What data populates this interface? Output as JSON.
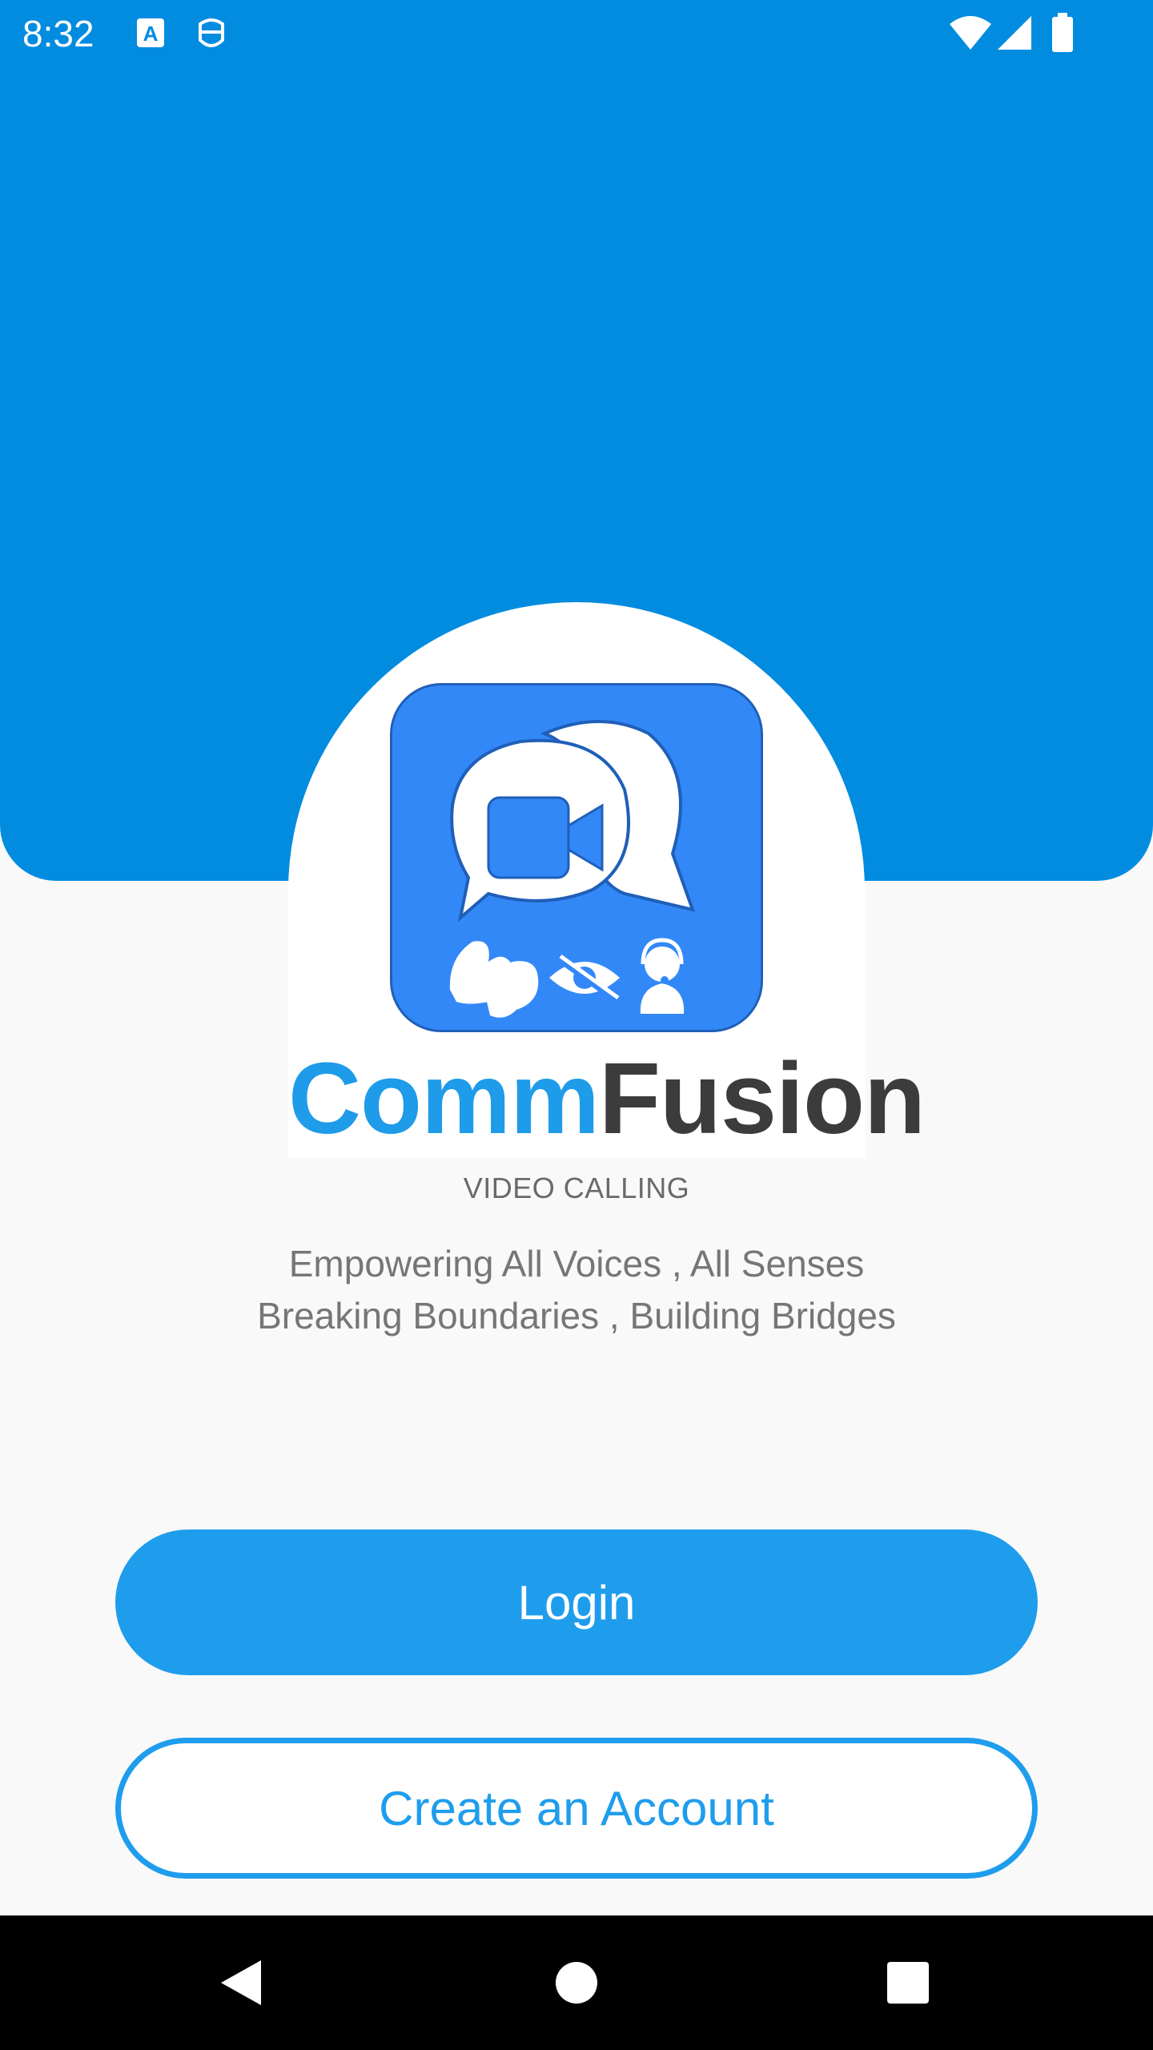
{
  "status_bar": {
    "time": "8:32",
    "icons": [
      "text-a-icon",
      "smile-face-icon",
      "wifi-icon",
      "signal-icon",
      "battery-icon"
    ]
  },
  "branding": {
    "name_part1": "Comm",
    "name_part2": "Fusion",
    "subtitle": "VIDEO CALLING",
    "tagline_line1": "Empowering All Voices , All Senses",
    "tagline_line2": "Breaking Boundaries , Building Bridges",
    "logo_icons": [
      "video-camera-icon",
      "sign-language-icon",
      "eye-slash-icon",
      "headset-person-icon"
    ]
  },
  "actions": {
    "login_label": "Login",
    "create_account_label": "Create an Account"
  },
  "nav_bar": {
    "icons": [
      "back-triangle-icon",
      "home-circle-icon",
      "recents-square-icon"
    ]
  },
  "colors": {
    "header_blue": "#028ce0",
    "brand_blue": "#1e9be9",
    "brand_dark": "#3c3c3c",
    "button_blue": "#1f9ded",
    "icon_blue": "#3388f7"
  }
}
